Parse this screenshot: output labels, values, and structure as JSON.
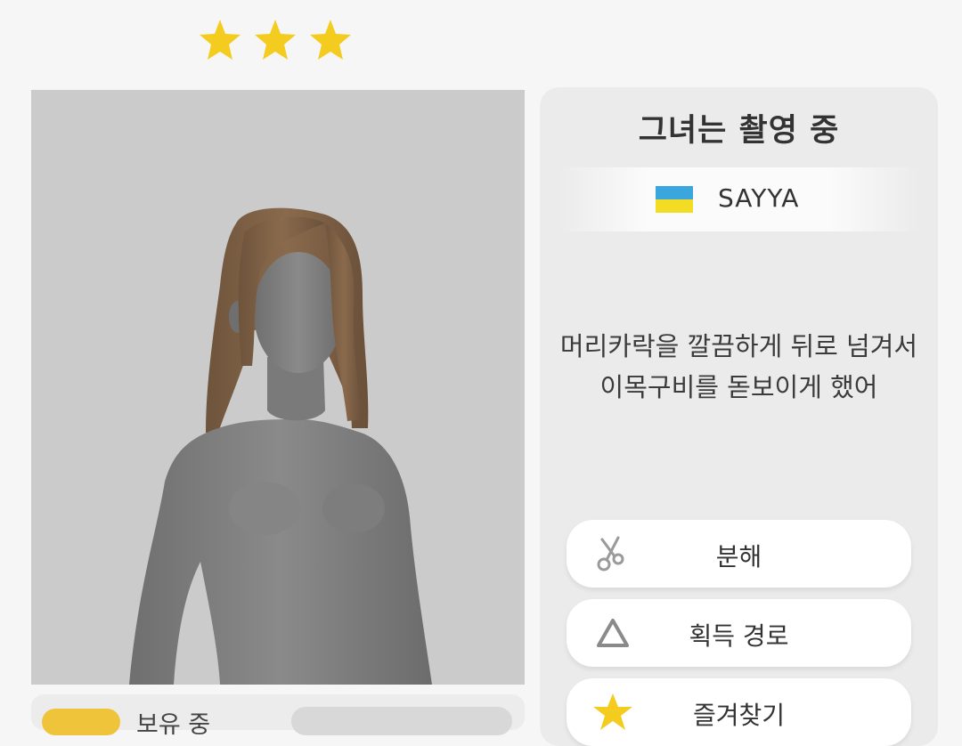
{
  "rating": {
    "stars": 3,
    "star_color": "#f4cc1f"
  },
  "preview": {
    "background": "#cbcbcb",
    "hair_color": "#7a5f45",
    "skin_color": "#808080"
  },
  "bottom_bar": {
    "owned_label": "보유 중",
    "badge_color": "#f0c43a"
  },
  "info": {
    "title": "그녀는 촬영 중",
    "player": {
      "flag": "ukraine-flag",
      "name": "SAYYA"
    },
    "description_line1": "머리카락을 깔끔하게 뒤로 넘겨서",
    "description_line2": "이목구비를 돋보이게 했어"
  },
  "actions": [
    {
      "label": "분해",
      "icon": "scissors-icon"
    },
    {
      "label": "획득 경로",
      "icon": "triangle-icon"
    },
    {
      "label": "즐겨찾기",
      "icon": "star-icon"
    }
  ]
}
